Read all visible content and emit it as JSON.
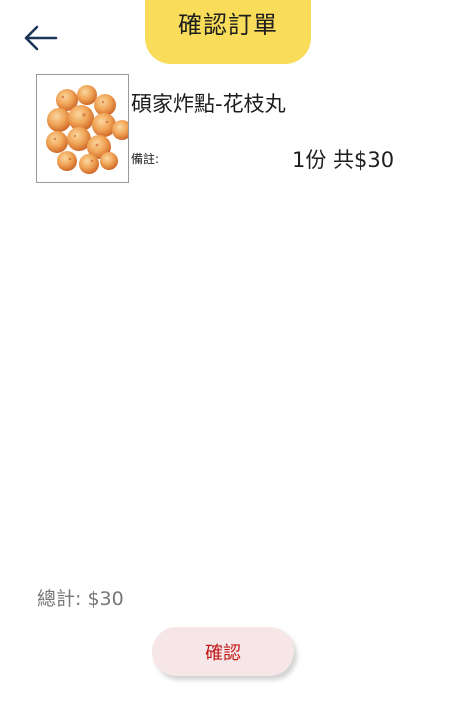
{
  "header": {
    "title": "確認訂單",
    "back_icon": "arrow-left-icon",
    "title_bg": "#f8dc5a"
  },
  "order_items": [
    {
      "name": "碩家炸點-花枝丸",
      "note_label": "備註:",
      "qty_price": "1份 共$30",
      "image": "fried-squid-balls-photo"
    }
  ],
  "summary": {
    "total": "總計: $30"
  },
  "actions": {
    "confirm_label": "確認",
    "confirm_bg": "#f6e6e7",
    "confirm_text_color": "#c01818"
  }
}
